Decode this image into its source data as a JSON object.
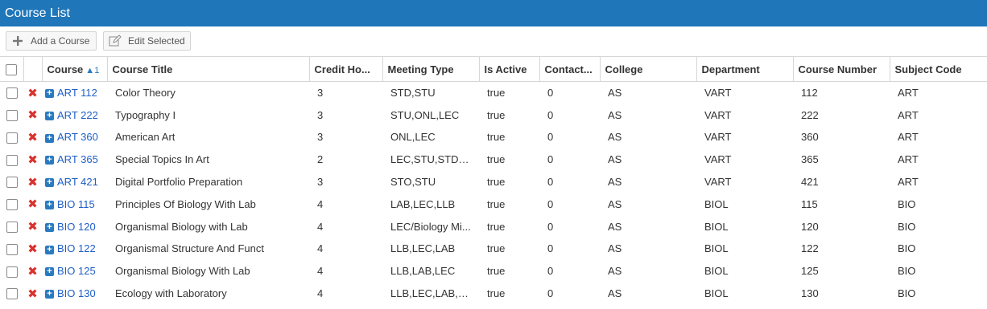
{
  "window": {
    "title": "Course List"
  },
  "toolbar": {
    "add_label": "Add a Course",
    "edit_label": "Edit Selected"
  },
  "columns": [
    "Course",
    "Course Title",
    "Credit Ho...",
    "Meeting Type",
    "Is Active",
    "Contact...",
    "College",
    "Department",
    "Course Number",
    "Subject Code"
  ],
  "sort_indicator": "1",
  "rows": [
    {
      "course": "ART 112",
      "title": "Color Theory",
      "credit": "3",
      "meeting": "STD,STU",
      "active": "true",
      "contact": "0",
      "college": "AS",
      "dept": "VART",
      "number": "112",
      "subject": "ART"
    },
    {
      "course": "ART 222",
      "title": "Typography I",
      "credit": "3",
      "meeting": "STU,ONL,LEC",
      "active": "true",
      "contact": "0",
      "college": "AS",
      "dept": "VART",
      "number": "222",
      "subject": "ART"
    },
    {
      "course": "ART 360",
      "title": "American Art",
      "credit": "3",
      "meeting": "ONL,LEC",
      "active": "true",
      "contact": "0",
      "college": "AS",
      "dept": "VART",
      "number": "360",
      "subject": "ART"
    },
    {
      "course": "ART 365",
      "title": "Special Topics In Art",
      "credit": "2",
      "meeting": "LEC,STU,STD,O...",
      "active": "true",
      "contact": "0",
      "college": "AS",
      "dept": "VART",
      "number": "365",
      "subject": "ART"
    },
    {
      "course": "ART 421",
      "title": "Digital Portfolio Preparation",
      "credit": "3",
      "meeting": "STO,STU",
      "active": "true",
      "contact": "0",
      "college": "AS",
      "dept": "VART",
      "number": "421",
      "subject": "ART"
    },
    {
      "course": "BIO 115",
      "title": "Principles Of Biology With Lab",
      "credit": "4",
      "meeting": "LAB,LEC,LLB",
      "active": "true",
      "contact": "0",
      "college": "AS",
      "dept": "BIOL",
      "number": "115",
      "subject": "BIO"
    },
    {
      "course": "BIO 120",
      "title": "Organismal Biology with Lab",
      "credit": "4",
      "meeting": "LEC/Biology Mi...",
      "active": "true",
      "contact": "0",
      "college": "AS",
      "dept": "BIOL",
      "number": "120",
      "subject": "BIO"
    },
    {
      "course": "BIO 122",
      "title": "Organismal Structure And Funct",
      "credit": "4",
      "meeting": "LLB,LEC,LAB",
      "active": "true",
      "contact": "0",
      "college": "AS",
      "dept": "BIOL",
      "number": "122",
      "subject": "BIO"
    },
    {
      "course": "BIO 125",
      "title": "Organismal Biology With Lab",
      "credit": "4",
      "meeting": "LLB,LAB,LEC",
      "active": "true",
      "contact": "0",
      "college": "AS",
      "dept": "BIOL",
      "number": "125",
      "subject": "BIO"
    },
    {
      "course": "BIO 130",
      "title": "Ecology with Laboratory",
      "credit": "4",
      "meeting": "LLB,LEC,LAB,L...",
      "active": "true",
      "contact": "0",
      "college": "AS",
      "dept": "BIOL",
      "number": "130",
      "subject": "BIO"
    }
  ],
  "colors": {
    "header_bar": "#1f76b9",
    "link": "#1f5fc7",
    "delete": "#d9332f"
  }
}
